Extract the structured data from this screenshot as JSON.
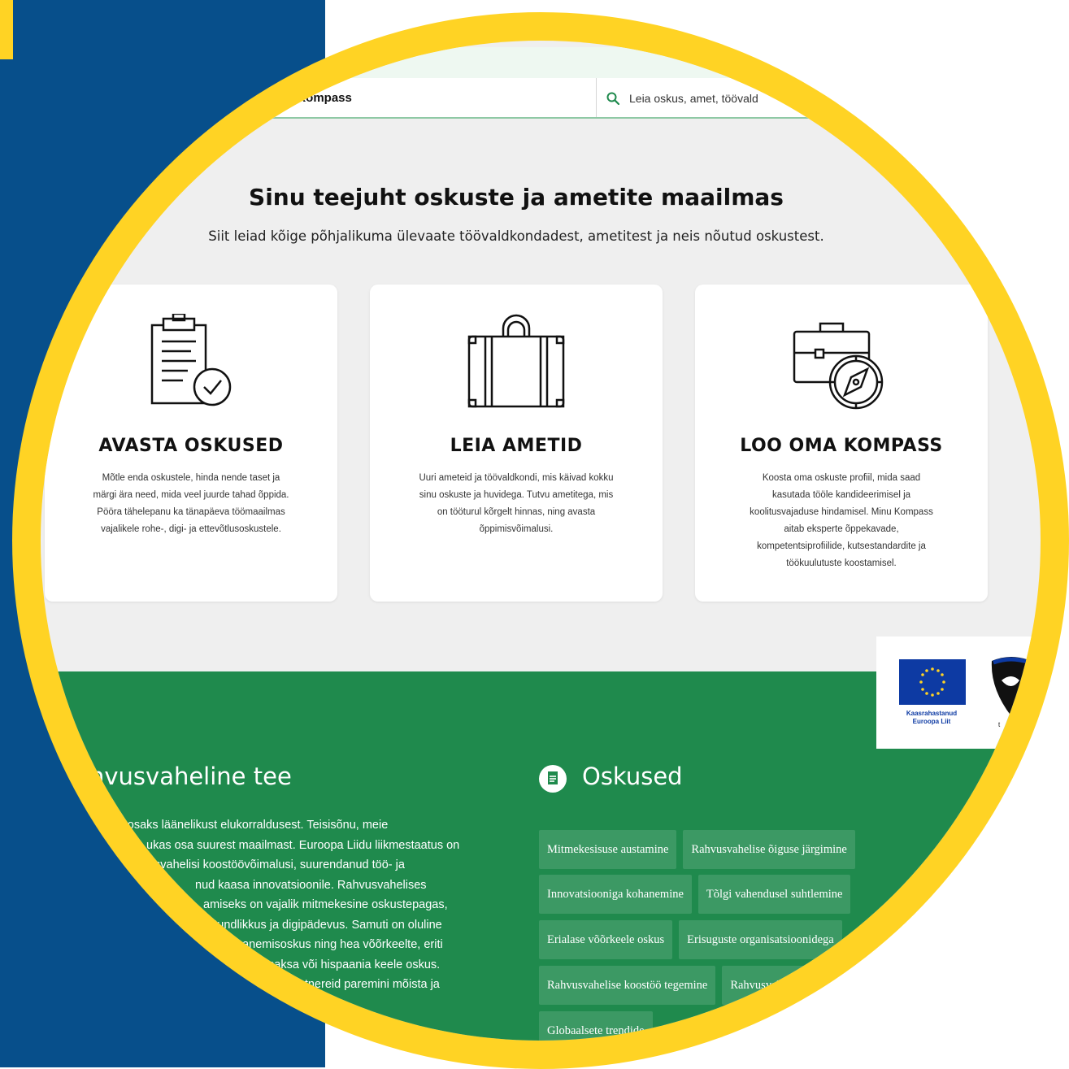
{
  "header": {
    "brand": "u Kompass",
    "search_placeholder": "Leia oskus, amet, töövald"
  },
  "hero": {
    "title": "Sinu teejuht oskuste ja ametite maailmas",
    "subtitle": "Siit leiad kõige põhjalikuma ülevaate töövaldkondadest, ametitest ja neis nõutud oskustest."
  },
  "cards": [
    {
      "icon": "clipboard-check-icon",
      "title": "AVASTA OSKUSED",
      "lines": [
        "Mõtle enda oskustele, hinda nende taset ja",
        "märgi ära need, mida veel juurde tahad õppida.",
        "Pööra tähelepanu ka tänapäeva töömaailmas",
        "vajalikele rohe-, digi- ja ettevõtlusoskustele."
      ]
    },
    {
      "icon": "suitcase-icon",
      "title": "LEIA AMETID",
      "lines": [
        "Uuri ameteid ja töövaldkondi, mis käivad kokku",
        "sinu oskuste ja huvidega. Tutvu ametitega, mis",
        "on tööturul kõrgelt hinnas, ning avasta",
        "õppimisvõimalusi."
      ]
    },
    {
      "icon": "briefcase-compass-icon",
      "title": "LOO OMA KOMPASS",
      "lines": [
        "Koosta oma oskuste profiil, mida saad",
        "kasutada tööle kandideerimisel ja",
        "koolitusvajaduse hindamisel. Minu Kompass",
        "aitab eksperte õppekavade,",
        "kompetentsiprofiilide, kutsestandardite ja",
        "töökuulutuste koostamisel."
      ]
    }
  ],
  "logos": {
    "eu_caption_1": "Kaasrahastanud",
    "eu_caption_2": "Euroopa Liit",
    "emblem_text": "t"
  },
  "section": {
    "title": "hvusvaheline tee",
    "lines": [
      "ee olla osaks läänelikust elukorraldusest. Teisisõnu, meie",
      "ukas osa suurest maailmast. Euroopa Liidu liikmestaatus on",
      "svahelisi koostöövõimalusi, suurendanud töö- ja",
      "nud kaasa innovatsioonile. Rahvusvahelises",
      "amiseks on vajalik mitmekesine oskustepagas,",
      "itundlikkus ja digipädevus. Samuti on oluline",
      "hanemisoskus ning hea võõrkeelte, eriti",
      "saksa või hispaania keele oskus.",
      "rtnereid paremini mõista ja"
    ]
  },
  "skills": {
    "title": "Oskused",
    "rows": [
      [
        "Mitmekesisuse austamine",
        "Rahvusvahelise õiguse järgimine"
      ],
      [
        "Innovatsiooniga kohanemine",
        "Tõlgi vahendusel suhtlemine"
      ],
      [
        "Erialase võõrkeele oskus",
        "Erisuguste organisatsioonidega"
      ],
      [
        "Rahvusvahelise koostöö tegemine",
        "Rahvusvaheline"
      ],
      [
        "Globaalsete trendide"
      ]
    ]
  },
  "colors": {
    "blue": "#074f8b",
    "yellow": "#ffd324",
    "green": "#1f8a4d"
  }
}
